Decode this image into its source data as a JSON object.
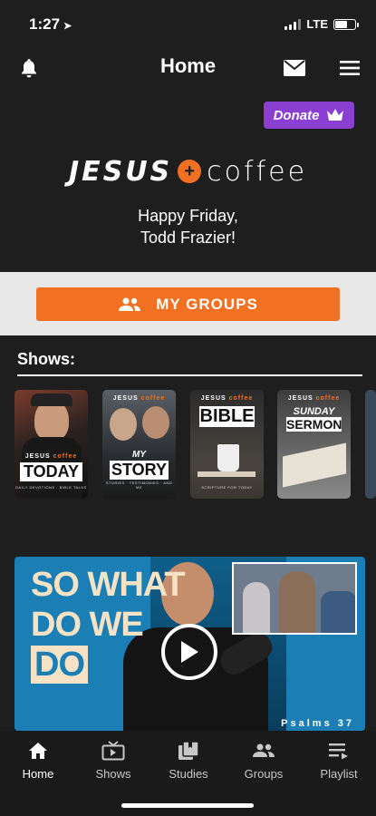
{
  "status": {
    "time": "1:27",
    "network": "LTE"
  },
  "header": {
    "title": "Home"
  },
  "donate": {
    "label": "Donate"
  },
  "logo": {
    "word1": "JESUS",
    "word2": "coffee"
  },
  "greeting": {
    "line1": "Happy Friday,",
    "line2": "Todd Frazier!"
  },
  "groups": {
    "label": "MY GROUPS"
  },
  "shows": {
    "label": "Shows:",
    "items": [
      {
        "brand": "JESUS",
        "brand2": "coffee",
        "title": "TODAY",
        "sub": "DAILY DEVOTIONS · BIBLE TALKS"
      },
      {
        "brand": "JESUS",
        "brand2": "coffee",
        "title_top": "MY",
        "title": "STORY",
        "sub": "STORIES · TESTIMONIES · AND ME"
      },
      {
        "brand": "JESUS",
        "brand2": "coffee",
        "title": "BIBLE",
        "sub": "SCRIPTURE FOR TODAY"
      },
      {
        "brand": "JESUS",
        "brand2": "coffee",
        "title_top": "SUNDAY",
        "title": "SERMON",
        "sub": ""
      }
    ]
  },
  "video": {
    "line1": "SO WHAT",
    "line2": "DO WE",
    "line3": "DO",
    "caption": "Psalms 37"
  },
  "tabs": [
    {
      "label": "Home",
      "icon": "home-icon"
    },
    {
      "label": "Shows",
      "icon": "tv-icon"
    },
    {
      "label": "Studies",
      "icon": "books-icon"
    },
    {
      "label": "Groups",
      "icon": "groups-icon"
    },
    {
      "label": "Playlist",
      "icon": "playlist-icon"
    }
  ],
  "colors": {
    "accent": "#f27021",
    "donate": "#8a3fd1",
    "background": "#1e1e1e",
    "groups_band": "#e8e8e8"
  }
}
